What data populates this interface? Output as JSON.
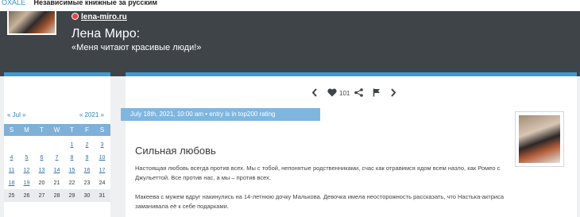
{
  "topbar": {
    "brand": "OXALE",
    "tagline": "Независимые книжные за русским"
  },
  "header": {
    "site_link": "lena-miro.ru",
    "author_name": "Лена Миро:",
    "author_motto": "«Меня читают красивые люди!»"
  },
  "calendar": {
    "prev_month": "« Jul »",
    "prev_year": "« 2021 »",
    "weekdays": [
      "S",
      "M",
      "T",
      "W",
      "T",
      "F",
      "S"
    ],
    "weeks": [
      [
        "",
        "",
        "",
        "",
        "1",
        "2",
        "3"
      ],
      [
        "4",
        "5",
        "6",
        "7",
        "8",
        "9",
        "10"
      ],
      [
        "11",
        "12",
        "13",
        "14",
        "15",
        "16",
        "17"
      ],
      [
        "18",
        "19",
        "20",
        "21",
        "22",
        "23",
        "24"
      ],
      [
        "25",
        "26",
        "27",
        "28",
        "29",
        "30",
        "31"
      ]
    ],
    "linked_days": [
      "1",
      "2",
      "3",
      "4",
      "5",
      "6",
      "7",
      "8",
      "9",
      "10",
      "11",
      "12",
      "13",
      "14",
      "15",
      "16",
      "17",
      "18",
      "19"
    ]
  },
  "toolbar": {
    "prev_icon": "chevron-left-icon",
    "like_icon": "heart-icon",
    "like_count": "101",
    "share_icon": "share-icon",
    "flag_icon": "flag-icon",
    "next_icon": "chevron-right-icon"
  },
  "post": {
    "date_line": "July 18th, 2021, 10:00 am • entry is in top200 rating",
    "title": "Сильная любовь",
    "paragraph1": "Настоящая любовь всегда против всех. Мы с тобой, непонятые родственниками, счас как отравимся ядом всем назло, как Ромео с Джульеттой. Все против нас, а мы – против всех.",
    "paragraph2": "Макеева с мужем вдруг накинулись на 14-летнюю дочку Малькова. Девочка имела неосторожность рассказать, что Настька-актриса заманивала её к себе подарками."
  },
  "colors": {
    "header_bg": "#3f4449",
    "accent": "#3e9ad6",
    "date_bar": "#7fb6e0",
    "calendar_head": "#7fb0d8"
  }
}
